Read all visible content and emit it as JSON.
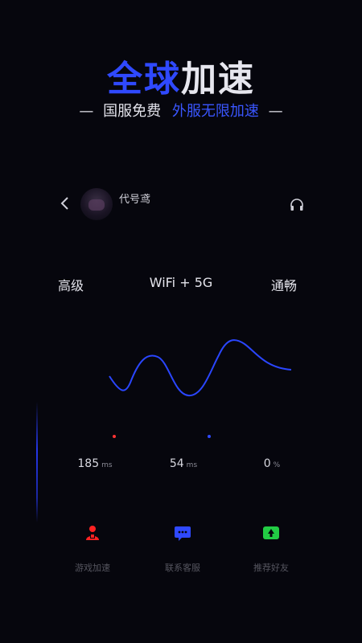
{
  "hero": {
    "title_part1": "全球",
    "title_part2": "加速",
    "tagline_dash_left": "—",
    "tagline_main": "国服免费",
    "tagline_highlight": "外服无限加速",
    "tagline_dash_right": "—"
  },
  "game": {
    "back_icon": "chevron-left-icon",
    "avatar_icon": "game-avatar",
    "name": "代号鸢",
    "headset_icon": "headset-icon"
  },
  "stats": {
    "mode": "高级",
    "network": "WiFi + 5G",
    "status": "通畅"
  },
  "metrics": [
    {
      "value": "185",
      "unit": "ms"
    },
    {
      "value": "54",
      "unit": "ms"
    },
    {
      "value": "0",
      "unit": "%"
    }
  ],
  "actions": [
    {
      "icon": "user-shield-icon",
      "label": "游戏加速",
      "color": "#ff2222"
    },
    {
      "icon": "chat-icon",
      "label": "联系客服",
      "color": "#2f49ff"
    },
    {
      "icon": "tree-icon",
      "label": "推荐好友",
      "color": "#22cc44"
    }
  ],
  "colors": {
    "accent": "#2f49ff",
    "background": "#06060d",
    "wave": "#2a46ff"
  }
}
